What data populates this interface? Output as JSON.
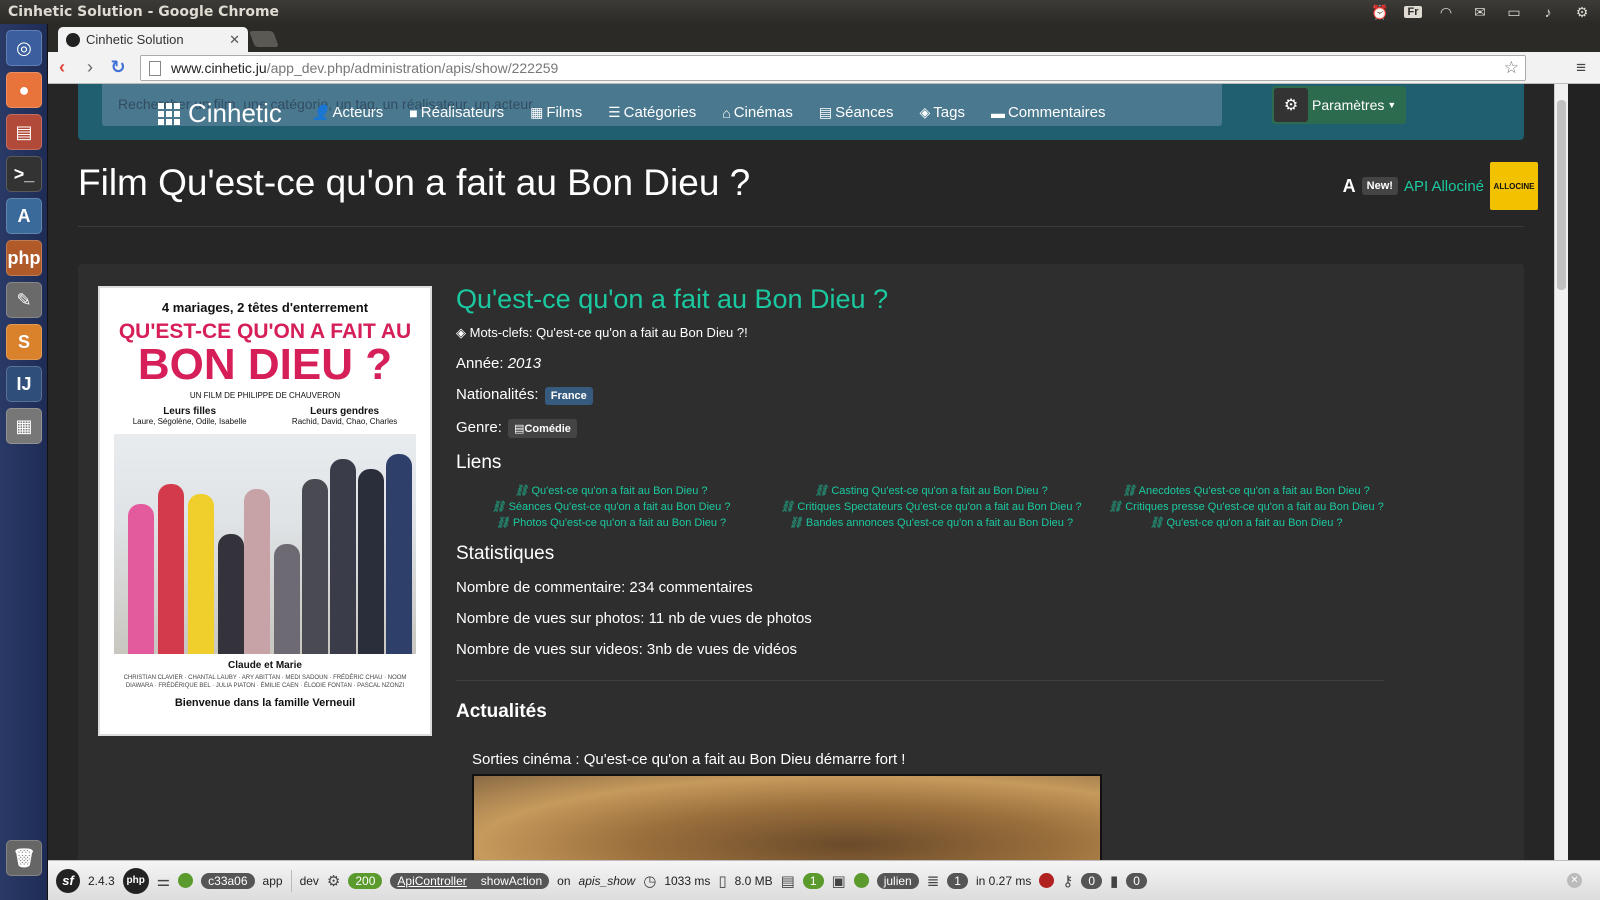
{
  "os": {
    "window_title": "Cinhetic Solution - Google Chrome",
    "tray_lang": "Fr",
    "tray_icons": [
      "alarm-clock-icon",
      "keyboard-lang-icon",
      "wifi-icon",
      "mail-icon",
      "battery-icon",
      "volume-icon",
      "gear-icon"
    ]
  },
  "launcher": {
    "items": [
      "ubuntu-dash-icon",
      "chrome-icon",
      "file-manager-icon",
      "terminal-icon",
      "inkscape-icon",
      "phpstorm-icon",
      "text-editor-icon",
      "sublime-text-icon",
      "intellij-icon",
      "calculator-icon",
      "trash-icon"
    ]
  },
  "browser": {
    "tab_title": "Cinhetic Solution",
    "url_host": "www.cinhetic.ju",
    "url_path": "/app_dev.php/administration/apis/show/222259"
  },
  "navbar": {
    "search_placeholder": "Rechercher un film, une catégorie, un tag, un réalisateur, un acteur...",
    "brand": "Cinhetic",
    "links": [
      "Acteurs",
      "Réalisateurs",
      "Films",
      "Catégories",
      "Cinémas",
      "Séances",
      "Tags",
      "Commentaires"
    ],
    "params": "Paramètres"
  },
  "header": {
    "title": "Film Qu'est-ce qu'on a fait au Bon Dieu ?",
    "new_badge": "New!",
    "api_link": "API Allociné",
    "logo_text": "ALLOCINE"
  },
  "poster": {
    "tagline": "4 mariages, 2 têtes d'enterrement",
    "title_line1": "QU'EST-CE QU'ON A FAIT AU",
    "title_line2": "BON DIEU ?",
    "director": "UN FILM DE PHILIPPE DE CHAUVERON",
    "daughters_title": "Leurs filles",
    "daughters_names": "Laure, Ségolène, Odile, Isabelle",
    "sons_title": "Leurs gendres",
    "sons_names": "Rachid, David, Chao, Charles",
    "parents": "Claude et Marie",
    "cast": "CHRISTIAN CLAVIER · CHANTAL LAUBY · ARY ABITTAN · MEDI SADOUN · FRÉDÉRIC CHAU · NOOM DIAWARA · FRÉDÉRIQUE BEL · JULIA PIATON · ÉMILIE CAEN · ÉLODIE FONTAN · PASCAL NZONZI",
    "welcome": "Bienvenue dans la famille Verneuil"
  },
  "film": {
    "heading": "Qu'est-ce qu'on a fait au Bon Dieu ?",
    "keywords_label": "Mots-clefs:",
    "keywords_value": "Qu'est-ce qu'on a fait au Bon Dieu ?!",
    "year_label": "Année:",
    "year": "2013",
    "nationality_label": "Nationalités:",
    "nationality": "France",
    "genre_label": "Genre:",
    "genre": "Comédie",
    "links_heading": "Liens",
    "links": [
      "Qu'est-ce qu'on a fait au Bon Dieu ?",
      "Casting Qu'est-ce qu'on a fait au Bon Dieu ?",
      "Anecdotes Qu'est-ce qu'on a fait au Bon Dieu ?",
      "Séances Qu'est-ce qu'on a fait au Bon Dieu ?",
      "Critiques Spectateurs Qu'est-ce qu'on a fait au Bon Dieu ?",
      "Critiques presse Qu'est-ce qu'on a fait au Bon Dieu ?",
      "Photos Qu'est-ce qu'on a fait au Bon Dieu ?",
      "Bandes annonces Qu'est-ce qu'on a fait au Bon Dieu ?",
      "Qu'est-ce qu'on a fait au Bon Dieu ?"
    ],
    "stats_heading": "Statistiques",
    "stats": [
      "Nombre de commentaire: 234 commentaires",
      "Nombre de vues sur photos: 11 nb de vues de photos",
      "Nombre de vues sur videos: 3nb de vues de vidéos"
    ],
    "news_heading": "Actualités",
    "news_item": "Sorties cinéma : Qu'est-ce qu'on a fait au Bon Dieu démarre fort !"
  },
  "debug_toolbar": {
    "sf_version": "2.4.3",
    "token": "c33a06",
    "env_app": "app",
    "env_dev": "dev",
    "status": "200",
    "controller": "ApiController",
    "action": "showAction",
    "route_prefix": "on",
    "route": "apis_show",
    "time": "1033 ms",
    "memory": "8.0 MB",
    "forms_count": "1",
    "user": "julien",
    "db_queries": "1",
    "db_time": "in 0.27 ms",
    "security_count": "0",
    "twig_count": "0"
  }
}
